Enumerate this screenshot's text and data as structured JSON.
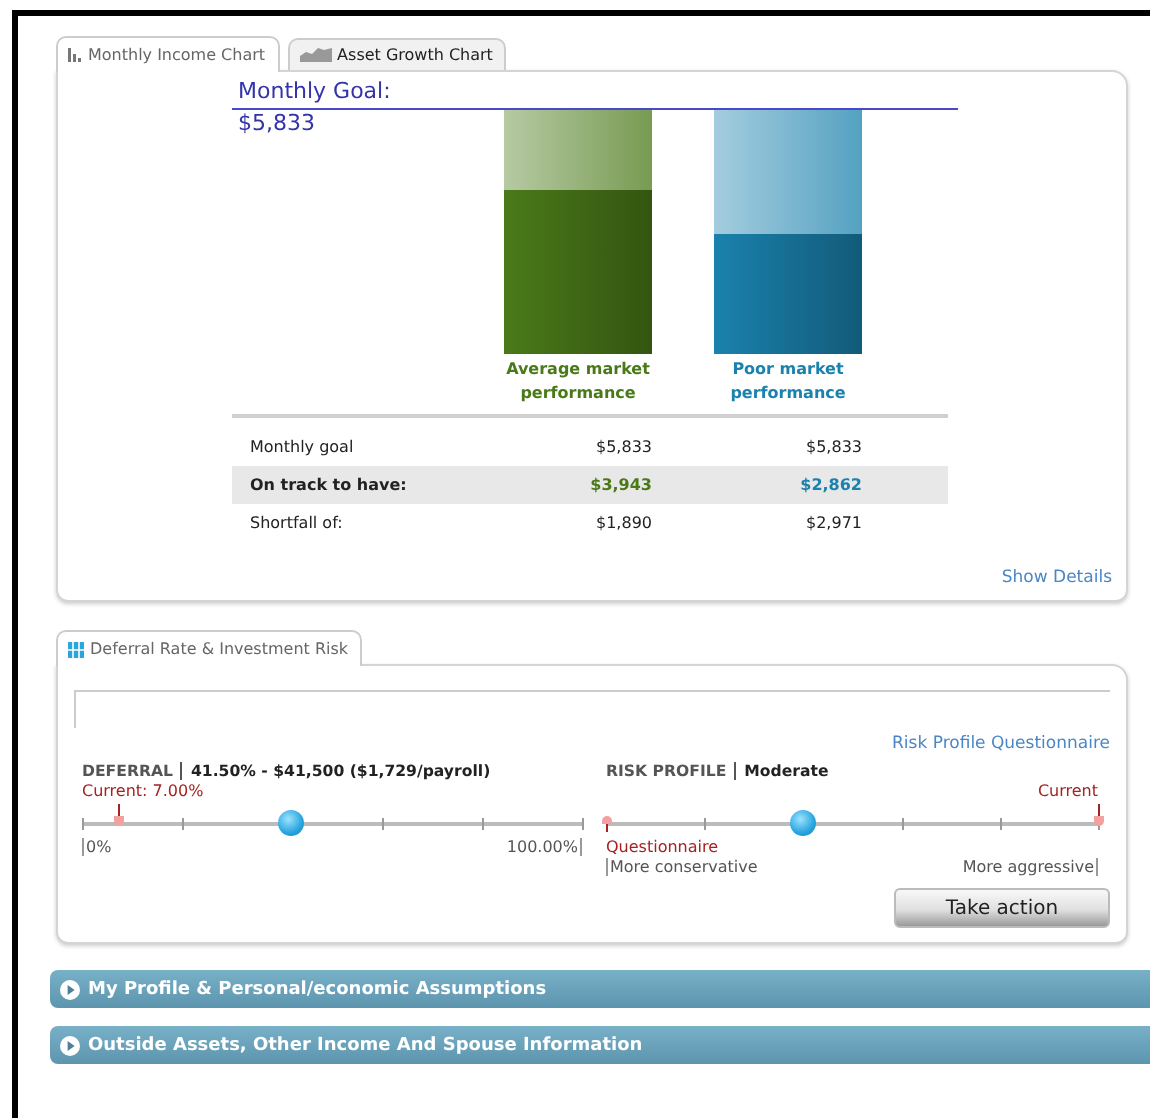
{
  "tabs": [
    {
      "label": "Monthly Income Chart",
      "selected": true
    },
    {
      "label": "Asset Growth Chart",
      "selected": false
    }
  ],
  "income_chart": {
    "goal_label": "Monthly Goal:",
    "goal_value": "$5,833",
    "bars": [
      {
        "label": "Average market performance",
        "level": 0.676,
        "color": "#4a7a18"
      },
      {
        "label": "Poor market performance",
        "level": 0.491,
        "color": "#1a82ad"
      }
    ]
  },
  "summary_table": {
    "rows": [
      {
        "label": "Monthly goal",
        "values": [
          "$5,833",
          "$5,833"
        ],
        "highlighted": false
      },
      {
        "label": "On track to have:",
        "values": [
          "$3,943",
          "$2,862"
        ],
        "highlighted": true
      },
      {
        "label": "Shortfall of:",
        "values": [
          "$1,890",
          "$2,971"
        ],
        "highlighted": false
      }
    ]
  },
  "show_details": "Show Details",
  "risk_tab": {
    "label": "Deferral Rate & Investment Risk",
    "selected": true
  },
  "risk_profile_link": "Risk Profile Questionnaire",
  "deferral": {
    "title": "DEFERRAL",
    "value": "41.50% - $41,500 ($1,729/payroll)",
    "level": 0.415,
    "current": {
      "label": "Current: 7.00%",
      "level": 0.07
    },
    "min_label": "0%",
    "max_label": "100.00%"
  },
  "risk_profile": {
    "title": "RISK PROFILE",
    "value": "Moderate",
    "level": 0.4,
    "current": {
      "label": "Current",
      "level": 1
    },
    "questionnaire": {
      "label": "Questionnaire",
      "level": 0
    },
    "min_label": "More conservative",
    "max_label": "More aggressive"
  },
  "take_action": "Take action",
  "sections": [
    {
      "title": "My Profile & Personal/economic Assumptions",
      "expanded": false
    },
    {
      "title": "Outside Assets, Other Income And Spouse Information",
      "expanded": false
    }
  ]
}
